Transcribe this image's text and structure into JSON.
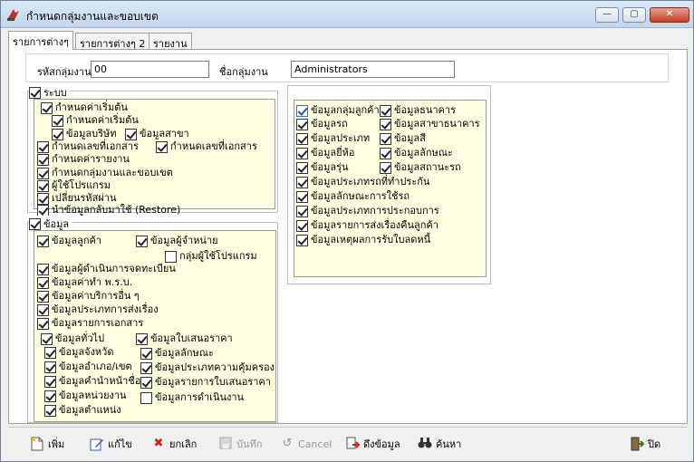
{
  "window": {
    "title": "กำหนดกลุ่มงานและขอบเขต"
  },
  "tabs": [
    {
      "label": "รายการต่างๆ"
    },
    {
      "label": "รายการต่างๆ 2"
    },
    {
      "label": "รายงาน"
    }
  ],
  "fields": {
    "group_code_label": "รหัสกลุ่มงาน",
    "group_code_value": "00",
    "group_name_label": "ชื่อกลุ่มงาน",
    "group_name_value": "Administrators"
  },
  "system": {
    "label": "ระบบ",
    "items": [
      {
        "label": "กำหนดค่าเริ่มต้น"
      },
      {
        "label": "กำหนดค่าเริ่มต้น"
      },
      {
        "label": "ข้อมูลบริษัท"
      },
      {
        "label": "ข้อมูลสาขา"
      },
      {
        "label": "กำหนดเลขที่เอกสาร"
      },
      {
        "label": "กำหนดเลขที่เอกสาร"
      },
      {
        "label": "กำหนดค่ารายงาน"
      },
      {
        "label": "กำหนดกลุ่มงานและขอบเขต"
      },
      {
        "label": "ผู้ใช้โปรแกรม"
      },
      {
        "label": "เปลี่ยนรหัสผ่าน"
      },
      {
        "label": "นำข้อมูลกลับมาใช้ (Restore)"
      }
    ]
  },
  "data_section": {
    "label": "ข้อมูล",
    "items": [
      {
        "label": "ข้อมูลลูกค้า"
      },
      {
        "label": "ข้อมูลผู้จำหน่าย"
      },
      {
        "label": "กลุ่มผู้ใช้โปรแกรม"
      },
      {
        "label": "ข้อมูลผู้ดำเนินการจดทะเบียน"
      },
      {
        "label": "ข้อมูลค่าทำ พ.ร.บ."
      },
      {
        "label": "ข้อมูลค่าบริการอื่น ๆ"
      },
      {
        "label": "ข้อมูลประเภทการส่งเรื่อง"
      },
      {
        "label": "ข้อมูลรายการเอกสาร"
      },
      {
        "label": "ข้อมูลทั่วไป"
      },
      {
        "label": "ข้อมูลใบเสนอราคา"
      },
      {
        "label": "ข้อมูลจังหวัด"
      },
      {
        "label": "ข้อมูลลักษณะ"
      },
      {
        "label": "ข้อมูลอำเภอ/เขต"
      },
      {
        "label": "ข้อมูลประเภทความคุ้มครอง"
      },
      {
        "label": "ข้อมูลคำนำหน้าชื่อ"
      },
      {
        "label": "ข้อมูลรายการใบเสนอราคา"
      },
      {
        "label": "ข้อมูลหน่วยงาน"
      },
      {
        "label": "ข้อมูลการดำเนินงาน"
      },
      {
        "label": "ข้อมูลตำแหน่ง"
      }
    ]
  },
  "right_section": {
    "items": [
      {
        "label": "ข้อมูลกลุ่มลูกค้า"
      },
      {
        "label": "ข้อมูลธนาคาร"
      },
      {
        "label": "ข้อมูลรถ"
      },
      {
        "label": "ข้อมูลสาขาธนาคาร"
      },
      {
        "label": "ข้อมูลประเภท"
      },
      {
        "label": "ข้อมูลสี"
      },
      {
        "label": "ข้อมูลยี่ห้อ"
      },
      {
        "label": "ข้อมูลลักษณะ"
      },
      {
        "label": "ข้อมูลรุ่น"
      },
      {
        "label": "ข้อมูลสถานะรถ"
      },
      {
        "label": "ข้อมูลประเภทรถที่ทำประกัน"
      },
      {
        "label": "ข้อมูลลักษณะการใช้รถ"
      },
      {
        "label": "ข้อมูลประเภทการประกอบการ"
      },
      {
        "label": "ข้อมูลรายการส่งเรื่องคืนลูกค้า"
      },
      {
        "label": "ข้อมูลเหตุผลการรับใบลดหนี้"
      }
    ]
  },
  "toolbar": {
    "add": "เพิ่ม",
    "edit": "แก้ไข",
    "cancel_th": "ยกเลิก",
    "save": "บันทึก",
    "cancel_en": "Cancel",
    "fetch": "ดึงข้อมูล",
    "search": "ค้นหา",
    "close": "ปิด"
  }
}
